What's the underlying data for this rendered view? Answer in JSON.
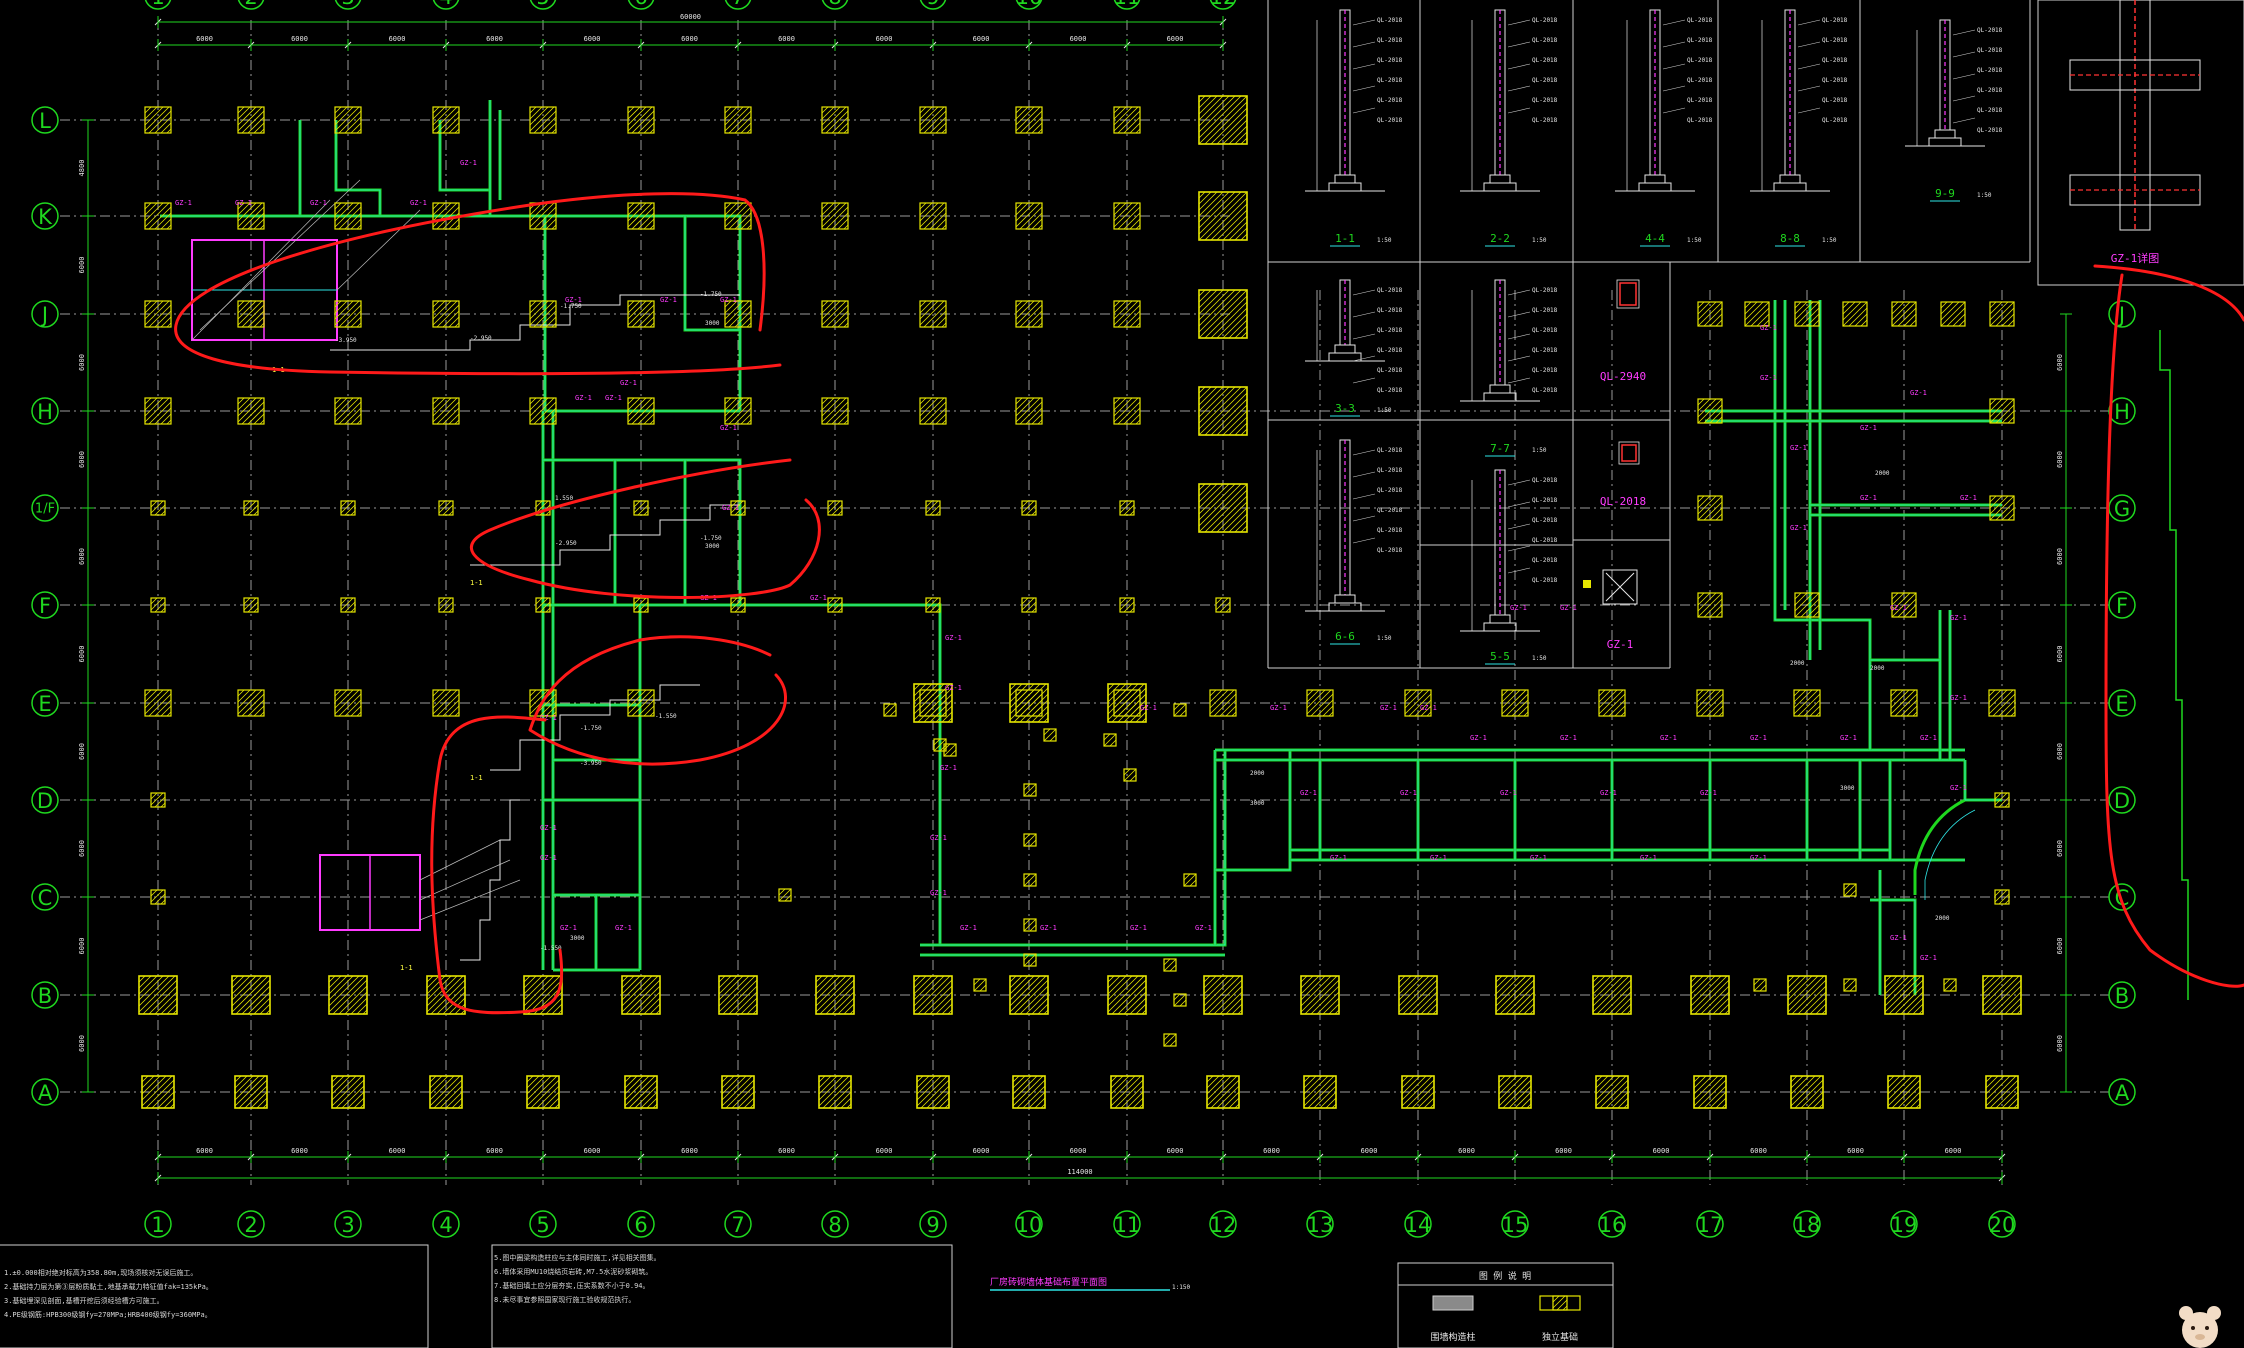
{
  "app": {
    "title": ""
  },
  "colors": {
    "background": "#000000",
    "axis": "#1fd81f",
    "grid": "#9a9a9a",
    "column": "#e6e600",
    "wall": "#1fd81f",
    "tag": "#ff3cff",
    "cyan": "#2ee6e6",
    "markup": "#ff1a1a",
    "dim": "#e6e6e6"
  },
  "axes": {
    "numbers": [
      "1",
      "2",
      "3",
      "4",
      "5",
      "6",
      "7",
      "8",
      "9",
      "10",
      "11",
      "12",
      "13",
      "14",
      "15",
      "16",
      "17",
      "18",
      "19",
      "20"
    ],
    "letters_left": [
      "L",
      "K",
      "J",
      "H",
      "1/F",
      "F",
      "E",
      "D",
      "C",
      "B",
      "A"
    ],
    "letters_right": [
      "J",
      "H",
      "G",
      "F",
      "E",
      "D",
      "C",
      "B",
      "A"
    ]
  },
  "dimensions": {
    "top_total": "60000",
    "top_spans": [
      "6000",
      "6000",
      "6000",
      "6000",
      "6000",
      "6000",
      "6000",
      "6000",
      "6000",
      "6000",
      "6000"
    ],
    "bottom_total": "114000",
    "bottom_spans": [
      "6000",
      "6000",
      "6000",
      "6000",
      "6000",
      "6000",
      "6000",
      "6000",
      "6000",
      "6000",
      "6000",
      "6000",
      "6000",
      "6000",
      "6000",
      "6000",
      "6000",
      "6000",
      "6000"
    ],
    "left_spans": [
      "4800",
      "6000",
      "6000",
      "6000",
      "6000",
      "6000",
      "6000",
      "6000",
      "6000",
      "6000"
    ],
    "right_spans": [
      "6000",
      "6000",
      "6000",
      "6000",
      "6000",
      "6000",
      "6000",
      "6000"
    ]
  },
  "labels": {
    "gz": "GZ-1",
    "ql": "QL-2018",
    "qz": "QZ-1",
    "dim_3000": "3000",
    "dim_2000": "2000",
    "dim_1500": "1500",
    "elev_a": "-1.750",
    "elev_b": "-2.950",
    "elev_c": "-3.950",
    "elev_d": "-1.550",
    "elev_e": "1.550"
  },
  "details": {
    "sections": [
      {
        "id": "1-1",
        "scale": "1:50"
      },
      {
        "id": "2-2",
        "scale": "1:50"
      },
      {
        "id": "4-4",
        "scale": "1:50"
      },
      {
        "id": "8-8",
        "scale": "1:50"
      },
      {
        "id": "9-9",
        "scale": "1:50"
      },
      {
        "id": "3-3",
        "scale": "1:50"
      },
      {
        "id": "7-7",
        "scale": "1:50"
      },
      {
        "id": "6-6",
        "scale": "1:50"
      },
      {
        "id": "5-5",
        "scale": "1:50"
      }
    ],
    "ql_2940": "QL-2940",
    "ql_2018": "QL-2018",
    "gz_1": "GZ-1",
    "gz_detail": "GZ-1详图"
  },
  "notes": {
    "block1": [
      "1.±0.000相对绝对标高为358.80m,现场须核对无误后施工。",
      "2.基础持力层为第③层粉质黏土,地基承载力特征值fak=135kPa。",
      "3.基础埋深见剖面,基槽开挖后须经验槽方可施工。",
      "4.PE级钢筋:HPB300级钢fy=270MPa;HRB400级钢fy=360MPa。"
    ],
    "block2": [
      "5.图中圈梁构造柱应与主体同时施工,详见相关图集。",
      "6.墙体采用MU10烧结页岩砖,M7.5水泥砂浆砌筑。",
      "7.基础回填土应分层夯实,压实系数不小于0.94。",
      "8.未尽事宜参照国家现行施工验收规范执行。"
    ],
    "drawing_title": "厂房砖砌墙体基础布置平面图",
    "drawing_scale": "1:150"
  },
  "legend": {
    "header": "图 例 说 明",
    "item1": "围墙构造柱",
    "item2": "独立基础"
  }
}
